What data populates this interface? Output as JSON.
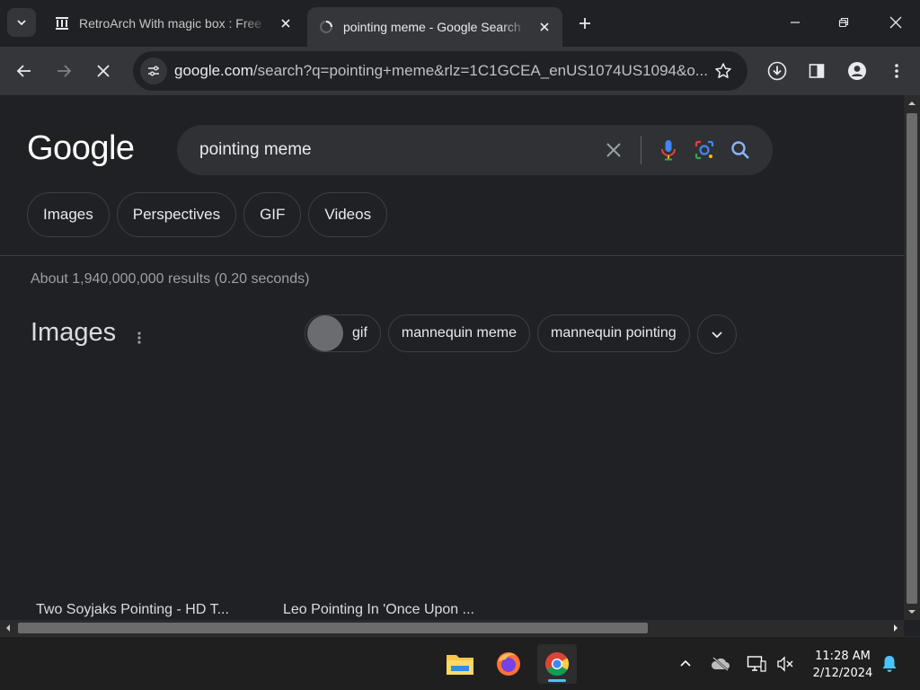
{
  "browser": {
    "tabs": [
      {
        "title": "RetroArch With magic box : Free",
        "favicon": "archive-org-icon",
        "active": false
      },
      {
        "title": "pointing meme - Google Search",
        "favicon": "loading-icon",
        "active": true
      }
    ],
    "address_bar": {
      "host": "google.com",
      "path": "/search?q=pointing+meme&rlz=1C1GCEA_enUS1074US1094&o..."
    }
  },
  "google": {
    "logo": "Google",
    "query": "pointing meme",
    "filter_chips": [
      "Images",
      "Perspectives",
      "GIF",
      "Videos"
    ],
    "results_stats": "About 1,940,000,000 results (0.20 seconds)",
    "images_section": {
      "heading": "Images",
      "refine_chips": [
        "gif",
        "mannequin meme",
        "mannequin pointing"
      ],
      "captions": [
        "Two Soyjaks Pointing - HD T...",
        "Leo Pointing In 'Once Upon ..."
      ]
    }
  },
  "taskbar": {
    "apps": [
      "file-explorer-icon",
      "firefox-icon",
      "chrome-icon"
    ],
    "time": "11:28 AM",
    "date": "2/12/2024"
  },
  "colors": {
    "page_bg": "#202124",
    "toolbar_bg": "#35363a",
    "search_bg": "#303134",
    "accent": "#8ab4f8"
  }
}
